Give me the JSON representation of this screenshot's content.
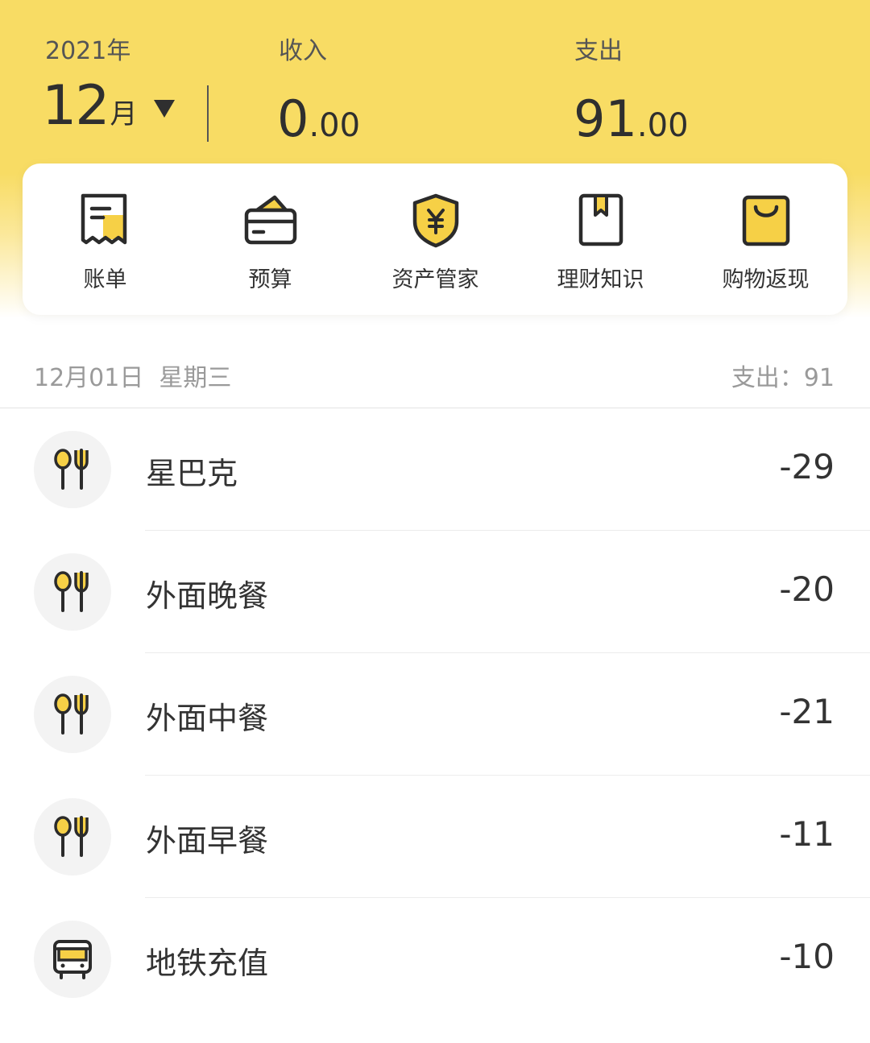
{
  "header": {
    "year": "2021年",
    "month_num": "12",
    "month_unit": "月",
    "income_label": "收入",
    "income_int": "0",
    "income_dec": ".00",
    "expense_label": "支出",
    "expense_int": "91",
    "expense_dec": ".00"
  },
  "menu": [
    {
      "label": "账单",
      "icon": "receipt-icon"
    },
    {
      "label": "预算",
      "icon": "wallet-icon"
    },
    {
      "label": "资产管家",
      "icon": "shield-yuan-icon"
    },
    {
      "label": "理财知识",
      "icon": "book-icon"
    },
    {
      "label": "购物返现",
      "icon": "shopping-bag-icon"
    }
  ],
  "day": {
    "date": "12月01日  星期三",
    "expense_summary": "支出：91"
  },
  "transactions": [
    {
      "name": "星巴克",
      "amount": "-29",
      "icon": "dining-icon"
    },
    {
      "name": "外面晚餐",
      "amount": "-20",
      "icon": "dining-icon"
    },
    {
      "name": "外面中餐",
      "amount": "-21",
      "icon": "dining-icon"
    },
    {
      "name": "外面早餐",
      "amount": "-11",
      "icon": "dining-icon"
    },
    {
      "name": "地铁充值",
      "amount": "-10",
      "icon": "bus-icon"
    }
  ],
  "colors": {
    "brand_yellow": "#f8dc64",
    "icon_yellow": "#f6d046",
    "text_dark": "#2f2f2f",
    "text_muted": "#9a9a9a"
  }
}
